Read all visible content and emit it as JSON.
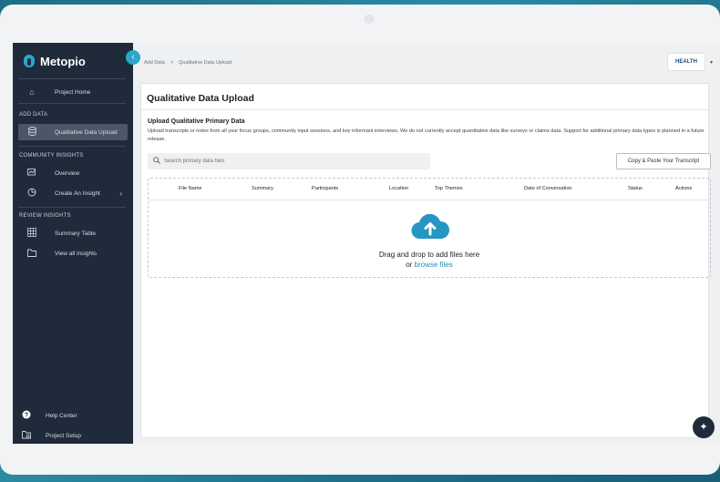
{
  "app": {
    "name": "Metopio"
  },
  "sidebar": {
    "items": [
      {
        "label": "Project Home",
        "icon": "home-icon"
      },
      {
        "label": "Qualitative Data Upload",
        "icon": "database-icon",
        "active": true
      },
      {
        "label": "Overview",
        "icon": "chart-icon"
      },
      {
        "label": "Create An Insight",
        "icon": "pie-icon"
      },
      {
        "label": "Summary Table",
        "icon": "grid-icon"
      },
      {
        "label": "View all insights",
        "icon": "folder-icon"
      }
    ],
    "sections": [
      "ADD DATA",
      "COMMUNITY INSIGHTS",
      "REVIEW INSIGHTS"
    ],
    "footer": [
      {
        "label": "Help Center",
        "icon": "help-icon"
      },
      {
        "label": "Project Setup",
        "icon": "settings-icon"
      }
    ]
  },
  "breadcrumb": {
    "parent": "Add Data",
    "separator": ">",
    "current": "Qualitative Data Upload"
  },
  "brand": {
    "text": "HEALTH"
  },
  "main": {
    "title": "Qualitative Data Upload",
    "section_title": "Upload Qualitative Primary Data",
    "description": "Upload transcripts or notes from all your focus groups, community input sessions, and key informant interviews. We do not currently accept quantitative data like surveys or claims data. Support for additional primary data types is planned in a future release.",
    "search_placeholder": "Search primary data files",
    "paste_button": "Copy & Paste Your Transcript",
    "columns": [
      "File Name",
      "Summary",
      "Participants",
      "Location",
      "Top Themes",
      "Date of Conversation",
      "Status",
      "Actions"
    ],
    "drop_text": "Drag and drop to add files here",
    "or_text": "or",
    "browse_text": "browse files"
  },
  "colors": {
    "sidebar": "#1f2b3b",
    "accent": "#2aa7c9",
    "link": "#2a8fb0"
  }
}
